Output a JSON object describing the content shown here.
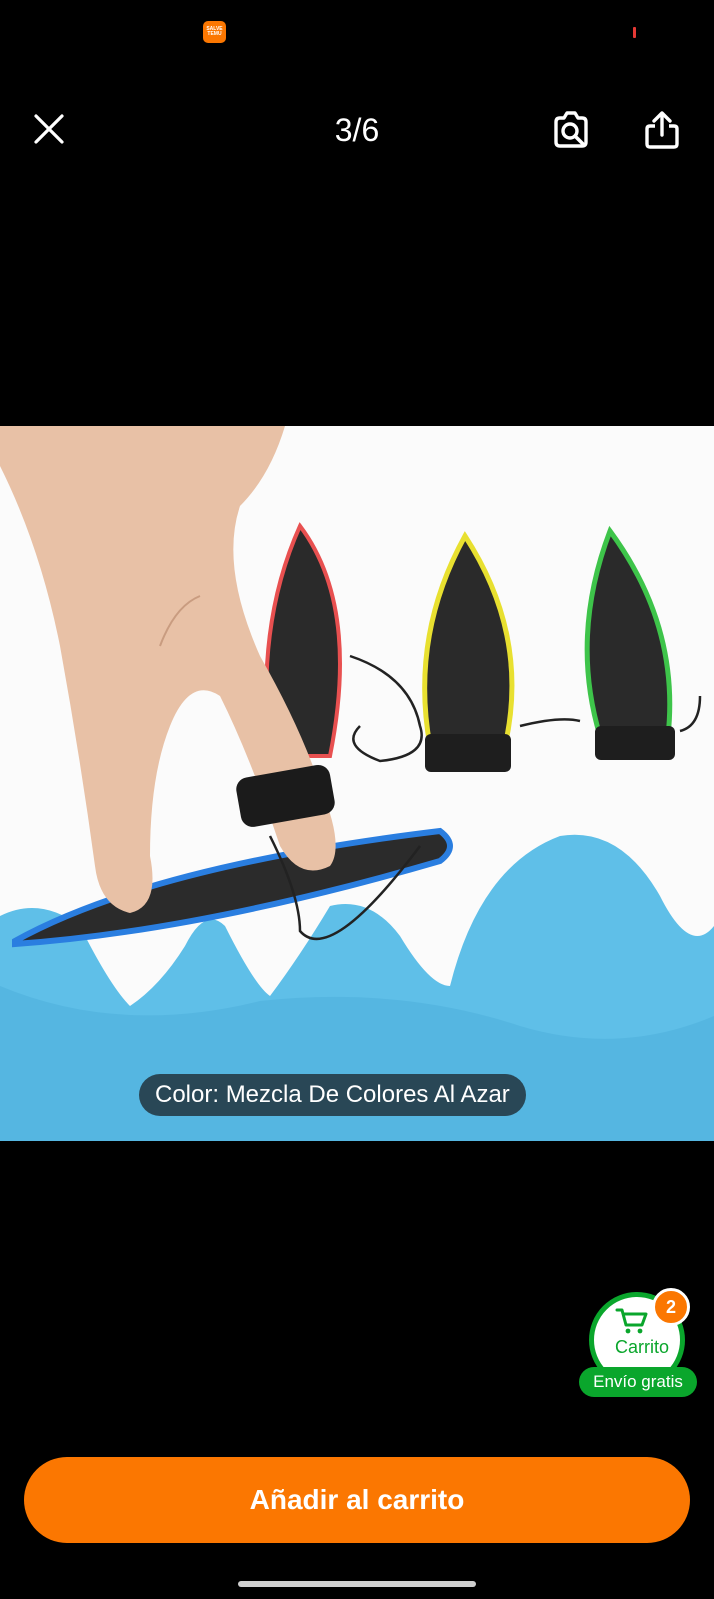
{
  "status_bar": {
    "app_icon_text": "SALVE TEMU",
    "app_icon_color": "#fb7701"
  },
  "viewer": {
    "counter": "3/6",
    "close_icon": "close-icon",
    "camera_search_icon": "camera-search-icon",
    "share_icon": "share-icon"
  },
  "product": {
    "image_alt": "Patineta de dedo tabla de surf",
    "color_label": "Color: Mezcla De Colores Al Azar"
  },
  "cart": {
    "label": "Carrito",
    "badge_count": "2",
    "free_shipping": "Envío gratis",
    "accent_color": "#0aa62c",
    "badge_color": "#fb7701"
  },
  "actions": {
    "add_to_cart": "Añadir al carrito",
    "button_color": "#fb7701"
  }
}
